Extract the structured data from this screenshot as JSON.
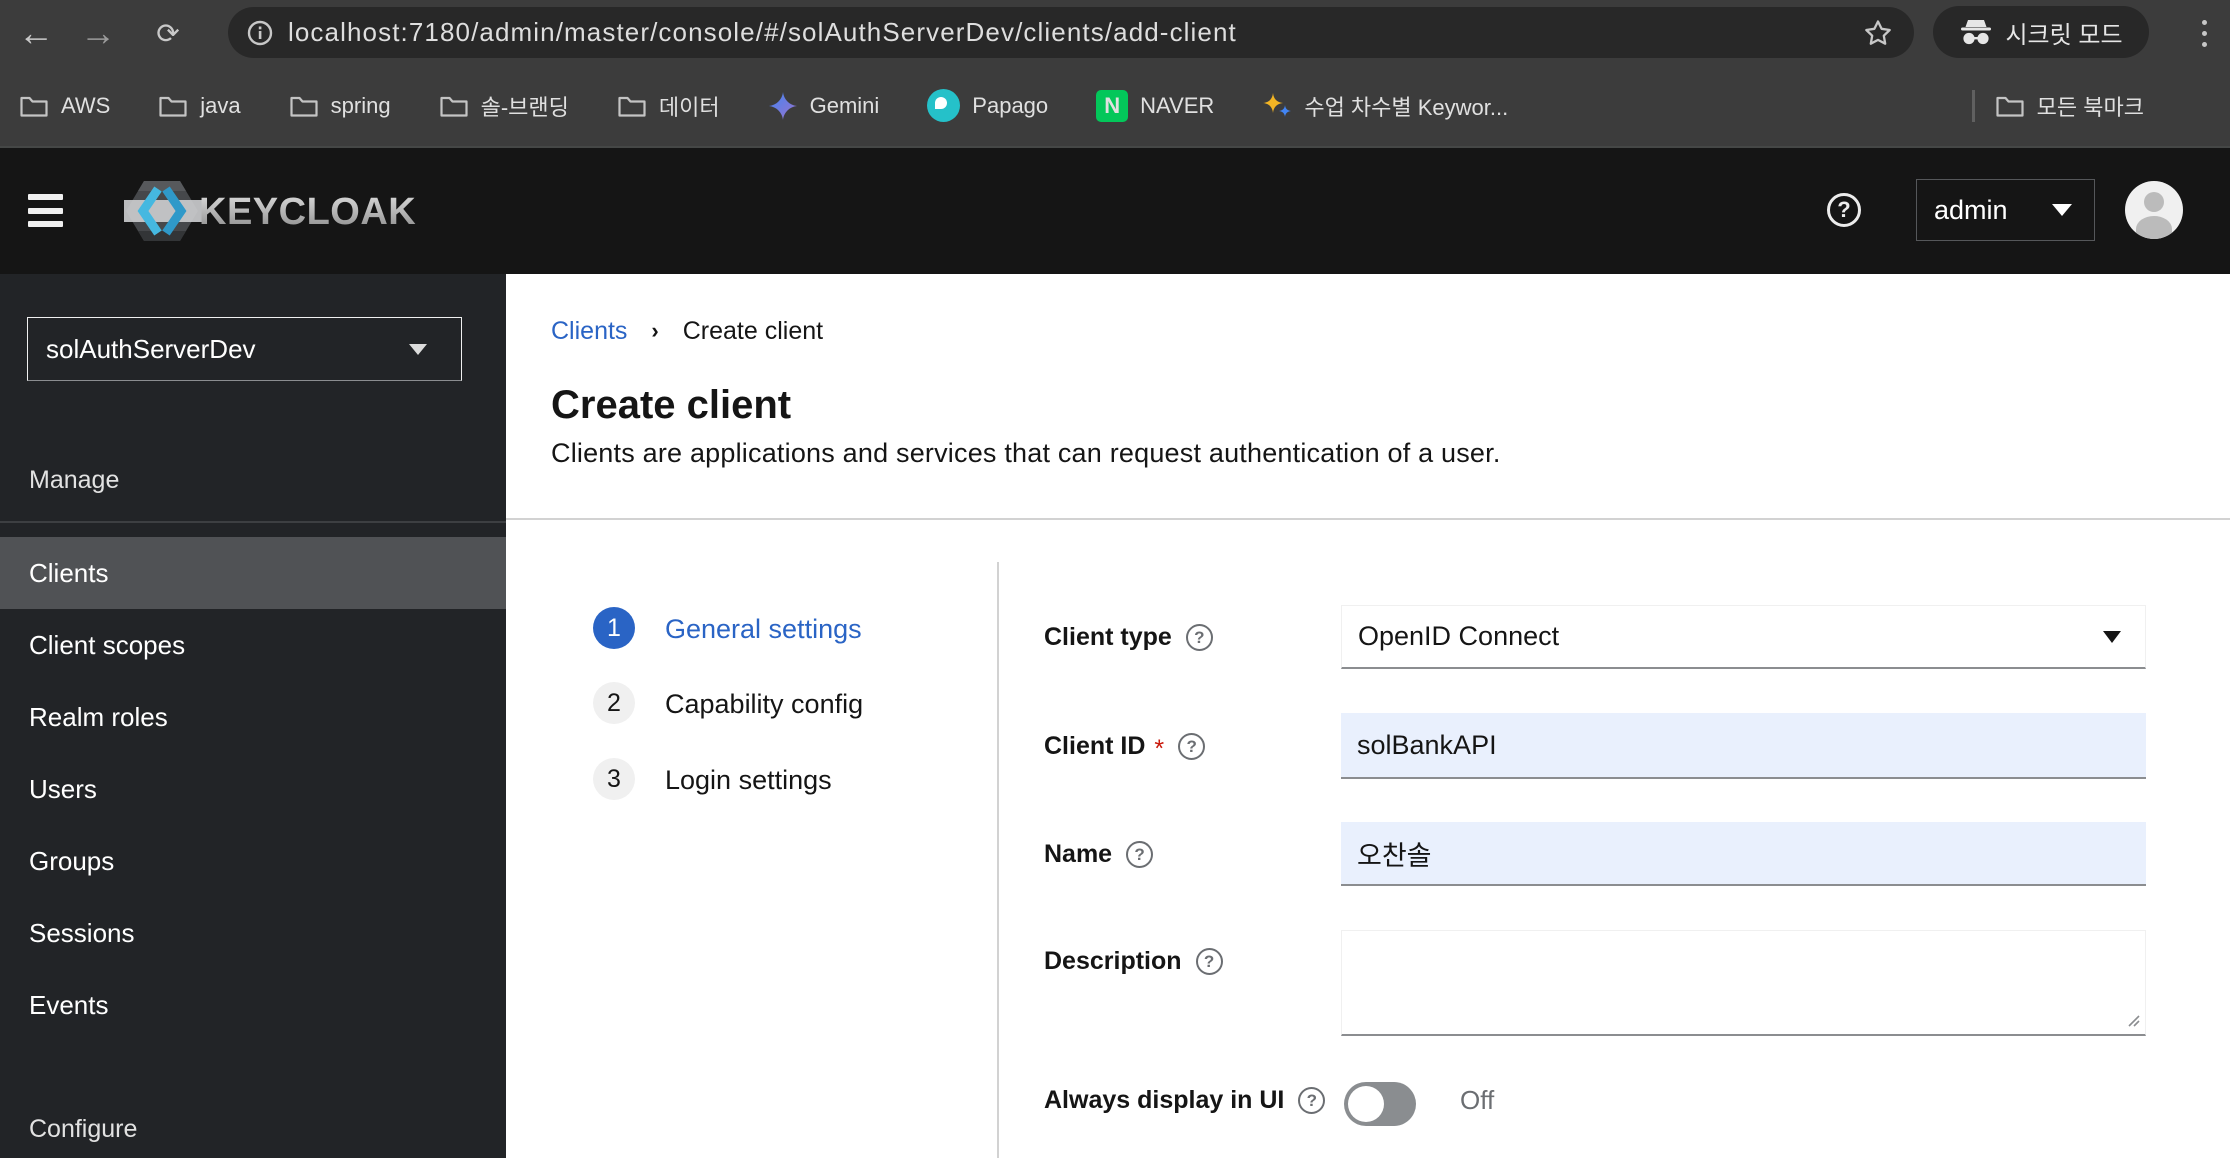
{
  "browser": {
    "url": "localhost:7180/admin/master/console/#/solAuthServerDev/clients/add-client",
    "incognito_label": "시크릿 모드",
    "bookmarks": [
      {
        "label": "AWS"
      },
      {
        "label": "java"
      },
      {
        "label": "spring"
      },
      {
        "label": "솔-브랜딩"
      },
      {
        "label": "데이터"
      },
      {
        "label": "Gemini"
      },
      {
        "label": "Papago"
      },
      {
        "label": "NAVER"
      },
      {
        "label": "수업 차수별 Keywor..."
      }
    ],
    "all_bookmarks_label": "모든 북마크",
    "naver_letter": "N"
  },
  "header": {
    "brand": "KEYCLOAK",
    "user": "admin",
    "help_glyph": "?"
  },
  "sidebar": {
    "realm": "solAuthServerDev",
    "section_manage": "Manage",
    "items": [
      "Clients",
      "Client scopes",
      "Realm roles",
      "Users",
      "Groups",
      "Sessions",
      "Events"
    ],
    "selected_item": "Clients",
    "section_configure": "Configure"
  },
  "main": {
    "breadcrumb": {
      "parent": "Clients",
      "current": "Create client"
    },
    "title": "Create client",
    "subtitle": "Clients are applications and services that can request authentication of a user.",
    "wizard": [
      {
        "num": "1",
        "label": "General settings"
      },
      {
        "num": "2",
        "label": "Capability config"
      },
      {
        "num": "3",
        "label": "Login settings"
      }
    ],
    "form": {
      "client_type": {
        "label": "Client type",
        "value": "OpenID Connect"
      },
      "client_id": {
        "label": "Client ID",
        "required_mark": "*",
        "value": "solBankAPI"
      },
      "name": {
        "label": "Name",
        "value": "오찬솔"
      },
      "description": {
        "label": "Description",
        "value": ""
      },
      "always_display": {
        "label": "Always display in UI",
        "state": "Off"
      }
    },
    "accent_color": "#2a64c5",
    "autofill_color": "#e9f0fd"
  }
}
